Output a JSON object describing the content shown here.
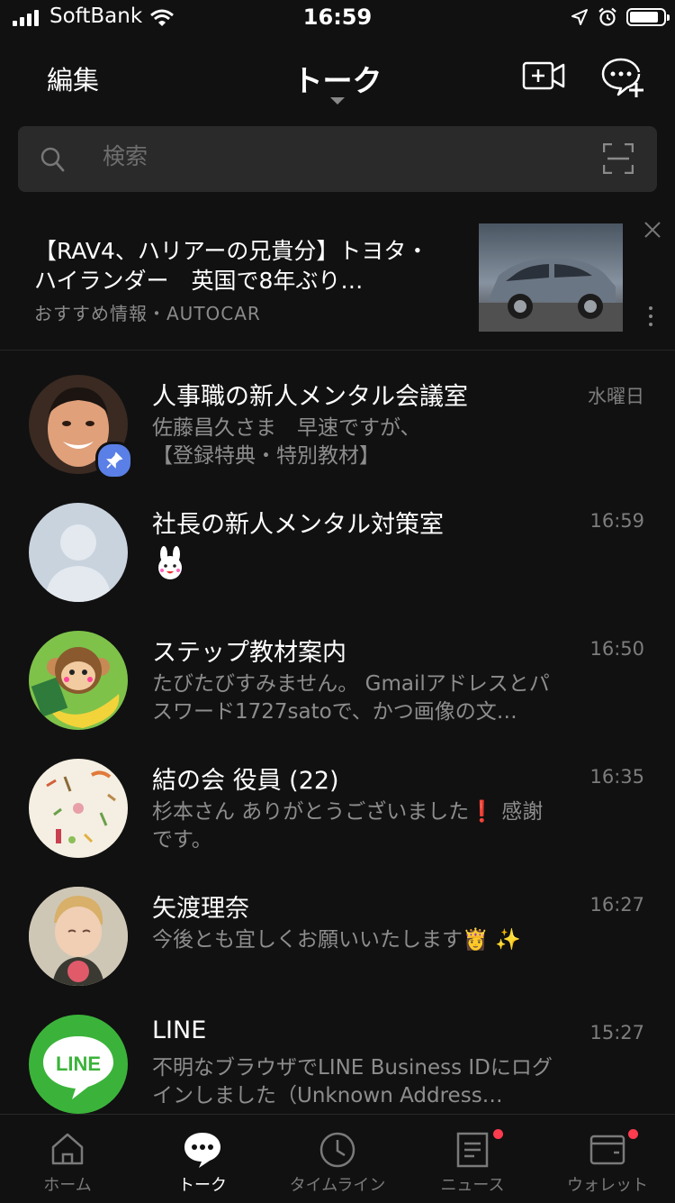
{
  "status_bar": {
    "carrier": "SoftBank",
    "time": "16:59"
  },
  "header": {
    "edit_label": "編集",
    "title": "トーク"
  },
  "search": {
    "placeholder": "検索"
  },
  "ad": {
    "title": "【RAV4、ハリアーの兄貴分】トヨタ・ハイランダー　英国で8年ぶり…",
    "source": "おすすめ情報・AUTOCAR"
  },
  "chats": [
    {
      "name": "人事職の新人メンタル会議室",
      "preview": "佐藤昌久さま　早速ですが、\n【登録特典・特別教材】",
      "time": "水曜日",
      "pinned": true
    },
    {
      "name": "社長の新人メンタル対策室",
      "preview": "",
      "time": "16:59",
      "sticker": "rabbit-sticker-icon"
    },
    {
      "name": "ステップ教材案内",
      "preview": "たびたびすみません。 Gmailアドレスとパスワード1727satoで、かつ画像の文…",
      "time": "16:50"
    },
    {
      "name": "結の会 役員 (22)",
      "preview": "杉本さん ありがとうございました❗ 感謝です。",
      "time": "16:35"
    },
    {
      "name": "矢渡理奈",
      "preview": "今後とも宜しくお願いいたします👸 ✨",
      "time": "16:27"
    },
    {
      "name": "LINE",
      "preview": "不明なブラウザでLINE Business IDにログインしました（Unknown Address…",
      "time": "15:27"
    }
  ],
  "tabs": [
    {
      "label": "ホーム",
      "icon": "home-icon"
    },
    {
      "label": "トーク",
      "icon": "talk-icon",
      "active": true
    },
    {
      "label": "タイムライン",
      "icon": "clock-icon"
    },
    {
      "label": "ニュース",
      "icon": "news-icon",
      "badge": true
    },
    {
      "label": "ウォレット",
      "icon": "wallet-icon",
      "badge": true
    }
  ],
  "colors": {
    "background": "#111111",
    "badge": "#ff3b4e",
    "pin": "#5a7fe6",
    "line_green": "#3bb33a"
  }
}
